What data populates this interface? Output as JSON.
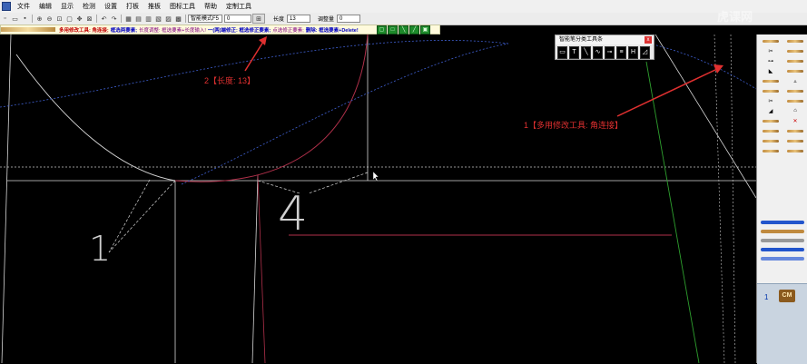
{
  "menu": [
    "文件",
    "编辑",
    "显示",
    "检测",
    "设置",
    "打板",
    "推板",
    "图标工具",
    "帮助",
    "定制工具"
  ],
  "toolbar": {
    "mode_select": "智能模式F5",
    "input_value": "0",
    "length_label": "长度",
    "length_value": "13",
    "adjust_label": "调整量",
    "adjust_value": "0"
  },
  "hint": {
    "part1": "多用修改工具: 角连接;",
    "part2": "框选两要素;",
    "part3": "长度调整: 框选要素+长度输入!",
    "part4": "一(两)端修正: 框选修正要素;",
    "part5": "点选修正要素;",
    "part6": "删除: 框选要素+Delete!"
  },
  "tool_panel": {
    "title": "智能笔分类工具条",
    "close": "x"
  },
  "annotations": {
    "a1": "2【长度: 13】",
    "a2": "1【多用修改工具: 角连接】"
  },
  "canvas_labels": {
    "n1": "1",
    "n4": "4"
  },
  "right_panel": {
    "page_num": "1",
    "cm_button": "CM"
  },
  "watermark": "虎课网",
  "colors": {
    "accent_red": "#e03030",
    "curve_red": "#b0304a",
    "guide_blue": "#3f5fd0",
    "green_line": "#2ea02e"
  }
}
